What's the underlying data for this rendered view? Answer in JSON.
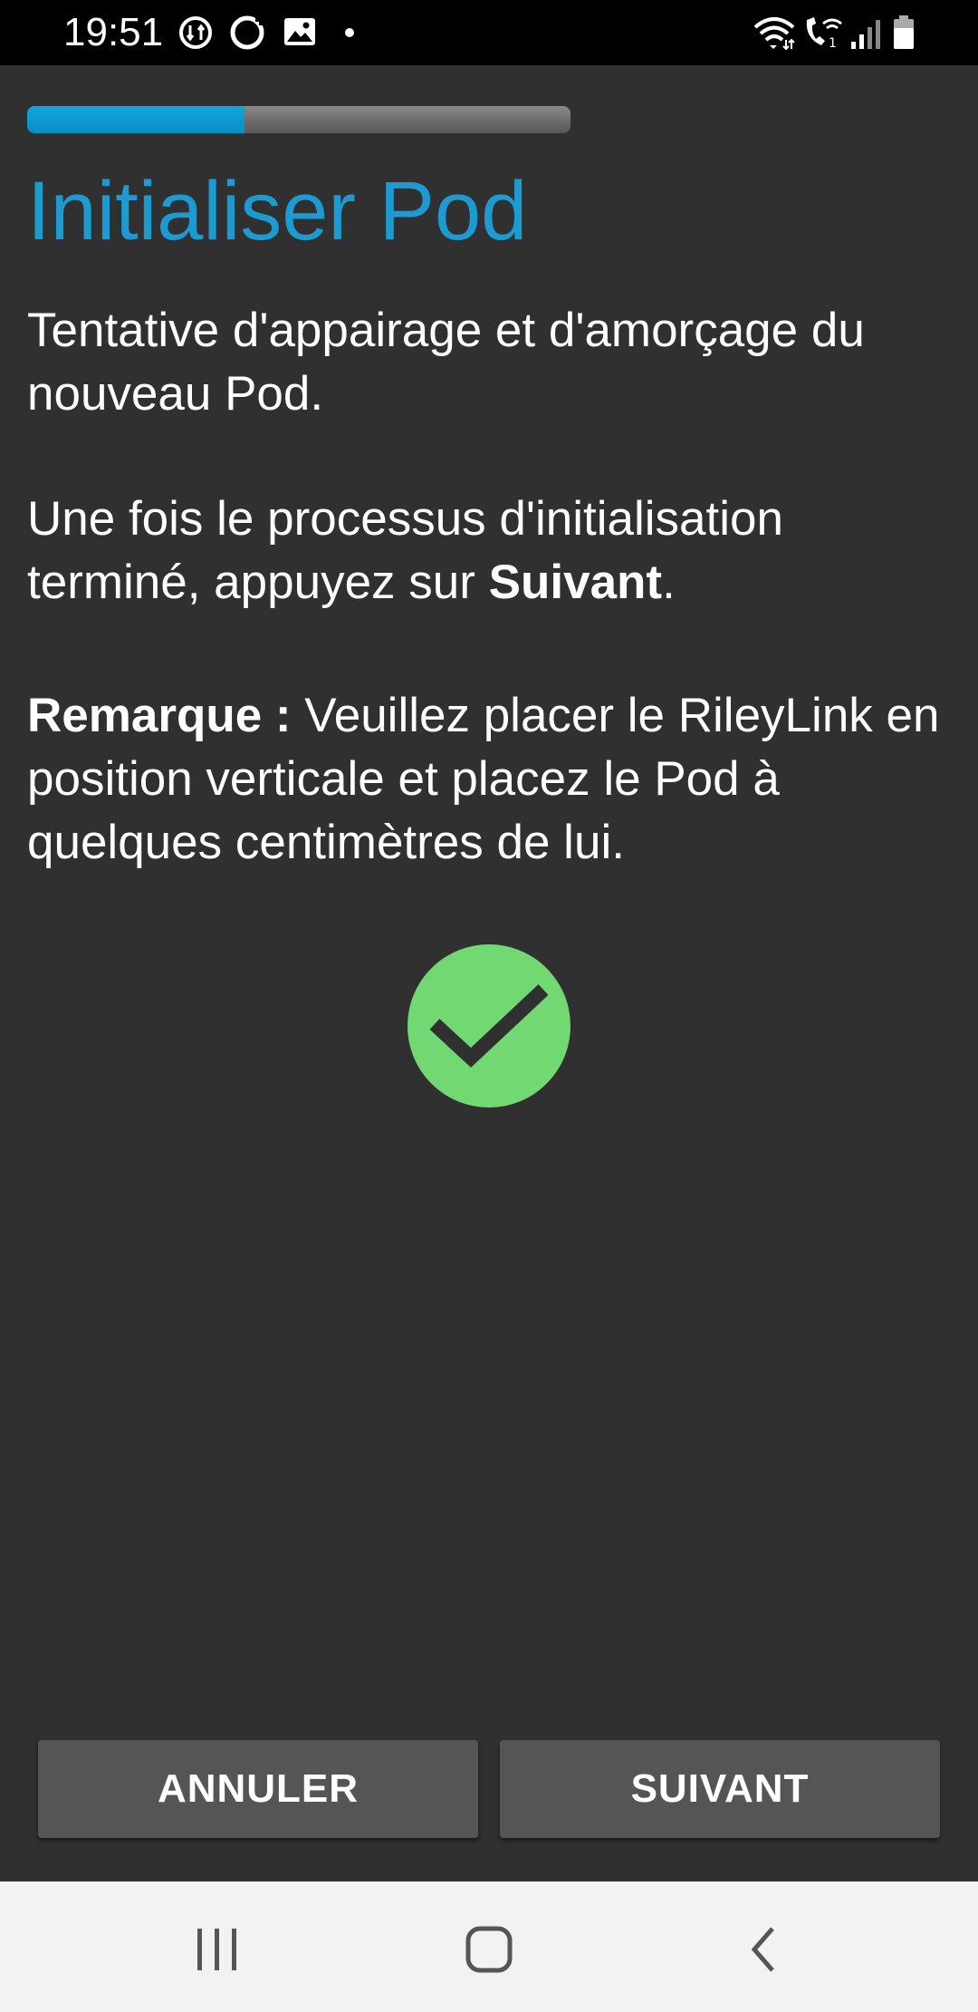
{
  "status_bar": {
    "time": "19:51",
    "left_icons": [
      "sync-icon",
      "circle-icon",
      "image-icon",
      "dot-icon"
    ],
    "right_icons": [
      "wifi-icon",
      "wifi-call-icon",
      "signal-icon",
      "battery-icon"
    ]
  },
  "wizard": {
    "progress": 0.4,
    "title": "Initialiser Pod",
    "paragraph1": "Tentative d'appairage et d'amorçage du nouveau Pod.",
    "paragraph2_part1": "Une fois le processus d'initialisation terminé, appuyez sur ",
    "paragraph2_bold": "Suivant",
    "paragraph2_part2": ".",
    "paragraph3_bold": "Remarque :",
    "paragraph3_rest": " Veuillez placer le RileyLink en position verticale et placez le Pod à quelques centimètres de lui.",
    "status_icon": "checkmark-circle-icon"
  },
  "buttons": {
    "cancel_label": "ANNULER",
    "next_label": "SUIVANT"
  },
  "nav": {
    "icons": [
      "recent-apps-icon",
      "home-icon",
      "back-icon"
    ]
  },
  "colors": {
    "accent": "#1b9bd1",
    "success": "#72d972",
    "background": "#303030"
  }
}
